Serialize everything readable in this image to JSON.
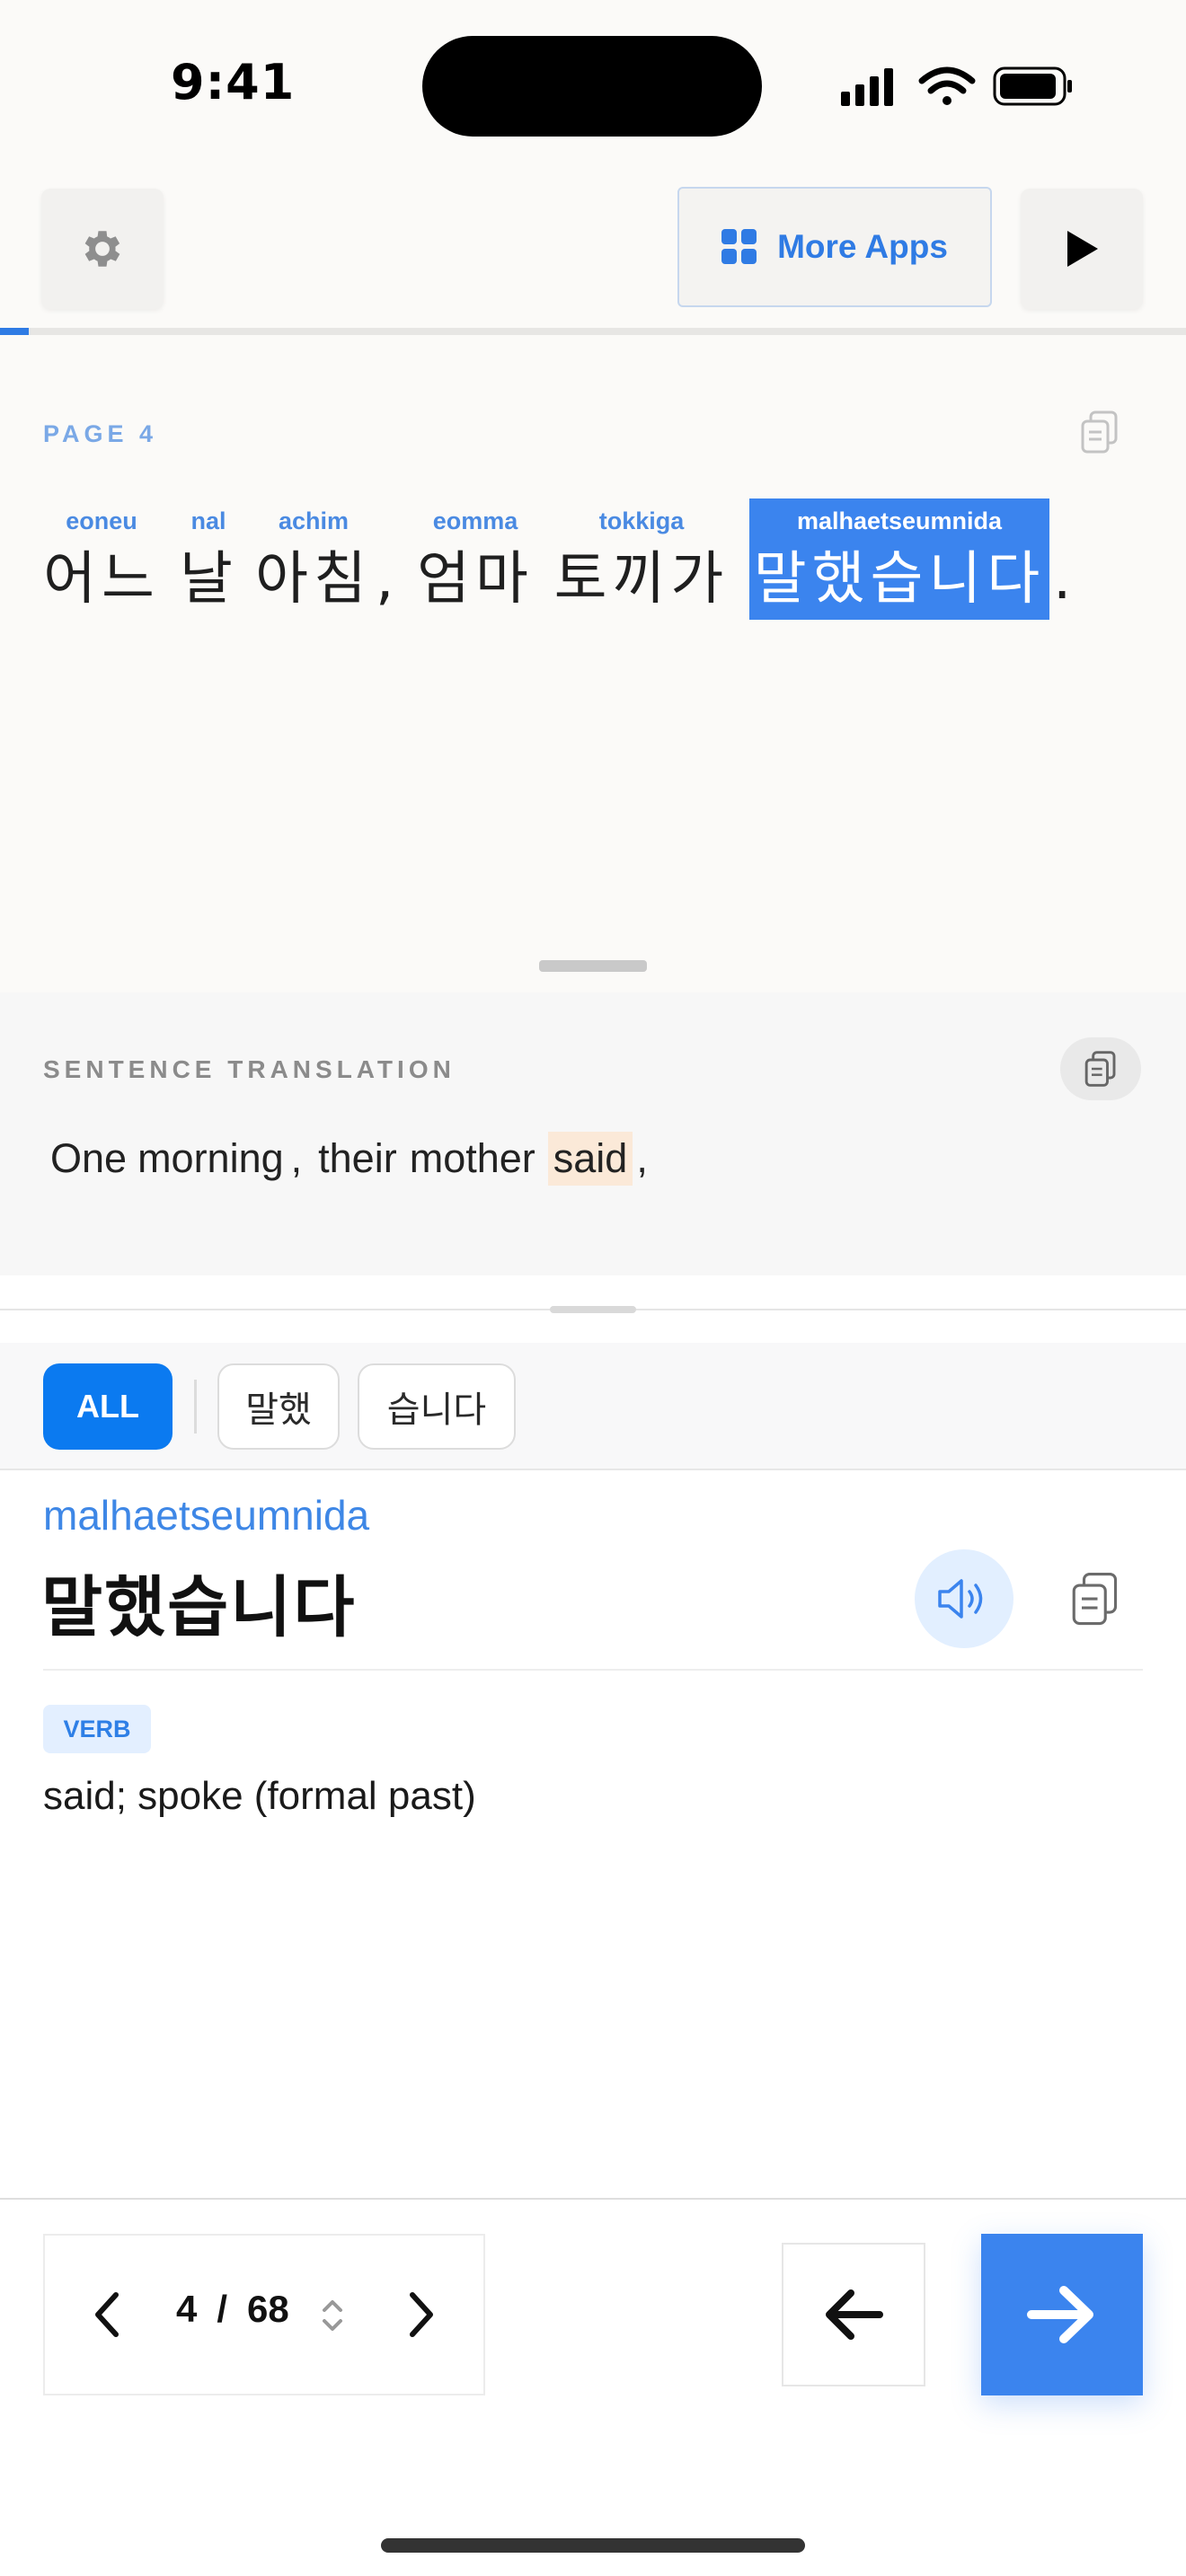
{
  "status_bar": {
    "time": "9:41"
  },
  "toolbar": {
    "more_apps_label": "More Apps",
    "progress_fraction": 0.024
  },
  "reading": {
    "page_label": "PAGE  4",
    "words": [
      {
        "romanization": "eoneu",
        "korean": "어느"
      },
      {
        "romanization": "nal",
        "korean": "날"
      },
      {
        "romanization": "achim",
        "korean": "아침"
      },
      {
        "romanization": "eomma",
        "korean": "엄마"
      },
      {
        "romanization": "tokkiga",
        "korean": "토끼가"
      },
      {
        "romanization": "malhaetseumnida",
        "korean": "말했습니다"
      }
    ],
    "comma": ",",
    "period": ".",
    "active_word_index": 5
  },
  "translation": {
    "label": "SENTENCE TRANSLATION",
    "words": [
      "One",
      "morning",
      ",",
      "their",
      "mother",
      "said",
      ","
    ],
    "highlighted_index": 5
  },
  "filters": {
    "all_label": "ALL",
    "chips": [
      "말했",
      "습니다"
    ]
  },
  "detail": {
    "romanization": "malhaetseumnida",
    "korean": "말했습니다",
    "part_of_speech": "VERB",
    "definition": "said; spoke (formal past)"
  },
  "pager": {
    "current": "4",
    "separator": "/",
    "total": "68"
  },
  "colors": {
    "accent": "#3b84ee",
    "highlight_translation": "#fbe9d8",
    "chip_all": "#0b7af0"
  }
}
